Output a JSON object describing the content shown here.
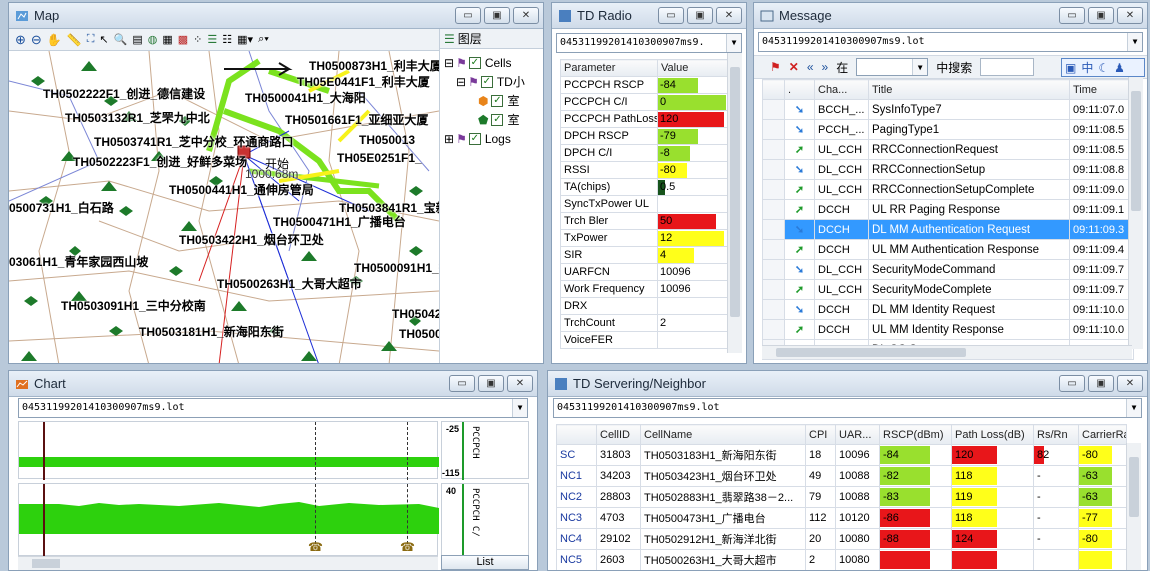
{
  "map": {
    "title": "Map",
    "layers_tab": "图层",
    "tree": {
      "cells": "Cells",
      "td": "TD小",
      "sub1": "室",
      "sub2": "室",
      "logs": "Logs"
    },
    "distance_label": "1000.68m",
    "start_label": "开始",
    "cell_labels": [
      "TH0500873H1_利丰大厦",
      "TH0502222F1_创进_德信建设",
      "TH05E0441F1_利丰大厦",
      "TH0503132R1_芝罘九中北",
      "TH0500041H1_大海阳",
      "TH0501661F1_亚细亚大厦",
      "TH0503741R1_芝中分校_环通商路口",
      "TH050013",
      "TH0502223F1_创进_好鲜多菜场",
      "TH05E0251F1_",
      "TH0500441H1_通伸房管局",
      "0500731H1_白石路",
      "TH0503841R1_宝新",
      "TH0500471H1_广播电台",
      "TH0503422H1_烟台环卫处",
      "03061H1_青年家园西山坡",
      "TH0500091H1_毓璜",
      "TH0500263H1_大哥大超市",
      "TH0503091H1_三中分校南",
      "TH050425",
      "TH0503181H1_新海阳东街",
      "TH0500"
    ]
  },
  "radio": {
    "title": "TD Radio",
    "combo": "04531199201410300907ms9.",
    "col_param": "Parameter",
    "col_value": "Value",
    "rows": [
      {
        "p": "PCCPCH RSCP",
        "v": "-84",
        "fill": 0.55,
        "color": "#99e02e"
      },
      {
        "p": "PCCPCH C/I",
        "v": "0",
        "fill": 0.95,
        "color": "#99e02e"
      },
      {
        "p": "PCCPCH PathLoss",
        "v": "120",
        "fill": 0.92,
        "color": "#e8161a"
      },
      {
        "p": "DPCH RSCP",
        "v": "-79",
        "fill": 0.55,
        "color": "#99e02e"
      },
      {
        "p": "DPCH C/I",
        "v": "-8",
        "fill": 0.45,
        "color": "#99e02e"
      },
      {
        "p": "RSSI",
        "v": "-80",
        "fill": 0.4,
        "color": "#ffff1a"
      },
      {
        "p": "TA(chips)",
        "v": "0.5",
        "fill": 0.1,
        "color": "#17541c"
      },
      {
        "p": "SyncTxPower UL",
        "v": "",
        "fill": 0,
        "color": "#ffffff"
      },
      {
        "p": "Trch Bler",
        "v": "50",
        "fill": 0.8,
        "color": "#e8161a"
      },
      {
        "p": "TxPower",
        "v": "12",
        "fill": 0.92,
        "color": "#ffff1a"
      },
      {
        "p": "SIR",
        "v": "4",
        "fill": 0.5,
        "color": "#ffff1a"
      },
      {
        "p": "UARFCN",
        "v": "10096",
        "fill": 0,
        "color": "#ffffff"
      },
      {
        "p": "Work Frequency",
        "v": "10096",
        "fill": 0,
        "color": "#ffffff"
      },
      {
        "p": "DRX",
        "v": "",
        "fill": 0,
        "color": "#ffffff"
      },
      {
        "p": "TrchCount",
        "v": "2",
        "fill": 0,
        "color": "#ffffff"
      },
      {
        "p": "VoiceFER",
        "v": "",
        "fill": 0,
        "color": "#ffffff"
      }
    ]
  },
  "message": {
    "title": "Message",
    "combo": "04531199201410300907ms9.lot",
    "toolbar_at": "在",
    "toolbar_search": "中搜索",
    "toolbar_mid": "中",
    "col_channel": "Cha...",
    "col_title": "Title",
    "col_time": "Time",
    "rows": [
      {
        "dir": "down",
        "ch": "BCCH_...",
        "t": "SysInfoType7",
        "time": "09:11:07.0"
      },
      {
        "dir": "down",
        "ch": "PCCH_...",
        "t": "PagingType1",
        "time": "09:11:08.5"
      },
      {
        "dir": "up",
        "ch": "UL_CCH",
        "t": "RRCConnectionRequest",
        "time": "09:11:08.5"
      },
      {
        "dir": "down",
        "ch": "DL_CCH",
        "t": "RRCConnectionSetup",
        "time": "09:11:08.8"
      },
      {
        "dir": "up",
        "ch": "UL_CCH",
        "t": "RRCConnectionSetupComplete",
        "time": "09:11:09.0"
      },
      {
        "dir": "up",
        "ch": "DCCH",
        "t": "UL RR Paging Response",
        "time": "09:11:09.1"
      },
      {
        "dir": "down",
        "ch": "DCCH",
        "t": "DL MM Authentication Request",
        "time": "09:11:09.3",
        "sel": true
      },
      {
        "dir": "up",
        "ch": "DCCH",
        "t": "UL MM Authentication Response",
        "time": "09:11:09.4"
      },
      {
        "dir": "down",
        "ch": "DL_CCH",
        "t": "SecurityModeCommand",
        "time": "09:11:09.7"
      },
      {
        "dir": "up",
        "ch": "UL_CCH",
        "t": "SecurityModeComplete",
        "time": "09:11:09.7"
      },
      {
        "dir": "down",
        "ch": "DCCH",
        "t": "DL MM Identity Request",
        "time": "09:11:10.0"
      },
      {
        "dir": "up",
        "ch": "DCCH",
        "t": "UL MM Identity Response",
        "time": "09:11:10.0"
      },
      {
        "dir": "down",
        "ch": "DCCH",
        "t": "DL CC Setup",
        "time": "09:11:10.1"
      }
    ]
  },
  "chart": {
    "title": "Chart",
    "combo": "04531199201410300907ms9.lot",
    "axis1_top": "-25",
    "axis1_bottom": "-115",
    "axis1_label": "PCCPCH",
    "axis2_top": "40",
    "axis2_label": "PCCPCH C/",
    "list_button": "List"
  },
  "serving": {
    "title": "TD Servering/Neighbor",
    "combo": "04531199201410300907ms9.lot",
    "headers": [
      "",
      "CellID",
      "CellName",
      "CPI",
      "UAR...",
      "RSCP(dBm)",
      "Path Loss(dB)",
      "Rs/Rn",
      "CarrierRa"
    ],
    "rows": [
      {
        "type": "SC",
        "id": "31803",
        "name": "TH0503183H1_新海阳东街",
        "cpi": "18",
        "uarfcn": "10096",
        "rscp": "-84",
        "rscp_c": "#99e02e",
        "pl": "120",
        "pl_c": "#e8161a",
        "rs": "82",
        "rs_c": "#e8161a",
        "cr": "-80",
        "cr_c": "#ffff1a"
      },
      {
        "type": "NC1",
        "id": "34203",
        "name": "TH0503423H1_烟台环卫处",
        "cpi": "49",
        "uarfcn": "10088",
        "rscp": "-82",
        "rscp_c": "#99e02e",
        "pl": "118",
        "pl_c": "#ffff1a",
        "rs": "-",
        "rs_c": "",
        "cr": "-63",
        "cr_c": "#99e02e"
      },
      {
        "type": "NC2",
        "id": "28803",
        "name": "TH0502883H1_翡翠路38－2...",
        "cpi": "79",
        "uarfcn": "10088",
        "rscp": "-83",
        "rscp_c": "#99e02e",
        "pl": "119",
        "pl_c": "#ffff1a",
        "rs": "-",
        "rs_c": "",
        "cr": "-63",
        "cr_c": "#99e02e"
      },
      {
        "type": "NC3",
        "id": "4703",
        "name": "TH0500473H1_广播电台",
        "cpi": "112",
        "uarfcn": "10120",
        "rscp": "-86",
        "rscp_c": "#e8161a",
        "pl": "118",
        "pl_c": "#ffff1a",
        "rs": "-",
        "rs_c": "",
        "cr": "-77",
        "cr_c": "#ffff1a"
      },
      {
        "type": "NC4",
        "id": "29102",
        "name": "TH0502912H1_新海洋北街",
        "cpi": "20",
        "uarfcn": "10080",
        "rscp": "-88",
        "rscp_c": "#e8161a",
        "pl": "124",
        "pl_c": "#e8161a",
        "rs": "-",
        "rs_c": "",
        "cr": "-80",
        "cr_c": "#ffff1a"
      },
      {
        "type": "NC5",
        "id": "2603",
        "name": "TH0500263H1_大哥大超市",
        "cpi": "2",
        "uarfcn": "10080",
        "rscp": "",
        "rscp_c": "#e8161a",
        "pl": "",
        "pl_c": "#e8161a",
        "rs": "",
        "rs_c": "",
        "cr": "",
        "cr_c": "#ffff1a"
      }
    ]
  },
  "colors": {
    "accent": "#3399ff",
    "good": "#99e02e",
    "warn": "#ffff1a",
    "bad": "#e8161a",
    "selected": "#3399ff"
  }
}
